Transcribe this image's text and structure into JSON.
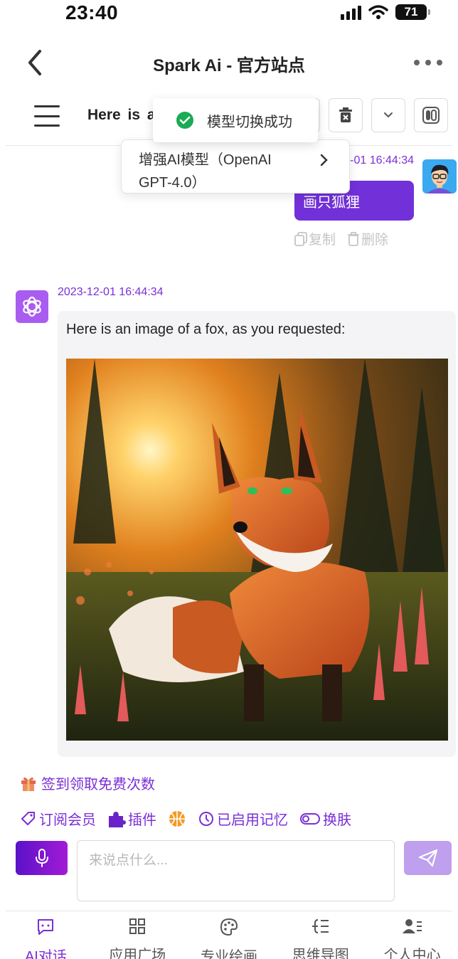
{
  "status_bar": {
    "time": "23:40",
    "battery": "71"
  },
  "nav": {
    "title": "Spark Ai - 官方站点"
  },
  "toolbar": {
    "title": "Here is a"
  },
  "model_dropdown": {
    "label": "增强AI模型（OpenAI GPT-4.0）"
  },
  "toast": {
    "message": "模型切换成功"
  },
  "messages": {
    "user": {
      "time": "2023-12-01 16:44:34",
      "text": "画只狐狸",
      "actions": {
        "copy": "复制",
        "delete": "删除"
      }
    },
    "bot": {
      "time": "2023-12-01 16:44:34",
      "text": "Here is an image of a fox, as you requested:"
    }
  },
  "bottom": {
    "checkin": "签到领取免费次数",
    "actions": {
      "subscribe": "订阅会员",
      "plugins": "插件",
      "memory": "已启用记忆",
      "skin": "换肤"
    },
    "input_placeholder": "来说点什么..."
  },
  "tabs": [
    {
      "label": "AI对话",
      "icon": "chat-icon"
    },
    {
      "label": "应用广场",
      "icon": "grid-icon"
    },
    {
      "label": "专业绘画",
      "icon": "palette-icon"
    },
    {
      "label": "思维导图",
      "icon": "mindmap-icon"
    },
    {
      "label": "个人中心",
      "icon": "user-icon"
    }
  ],
  "colors": {
    "accent": "#7b2fd6",
    "user_bubble": "#7230d9",
    "send_button": "#bea0ee",
    "toast_success": "#1aab55"
  }
}
